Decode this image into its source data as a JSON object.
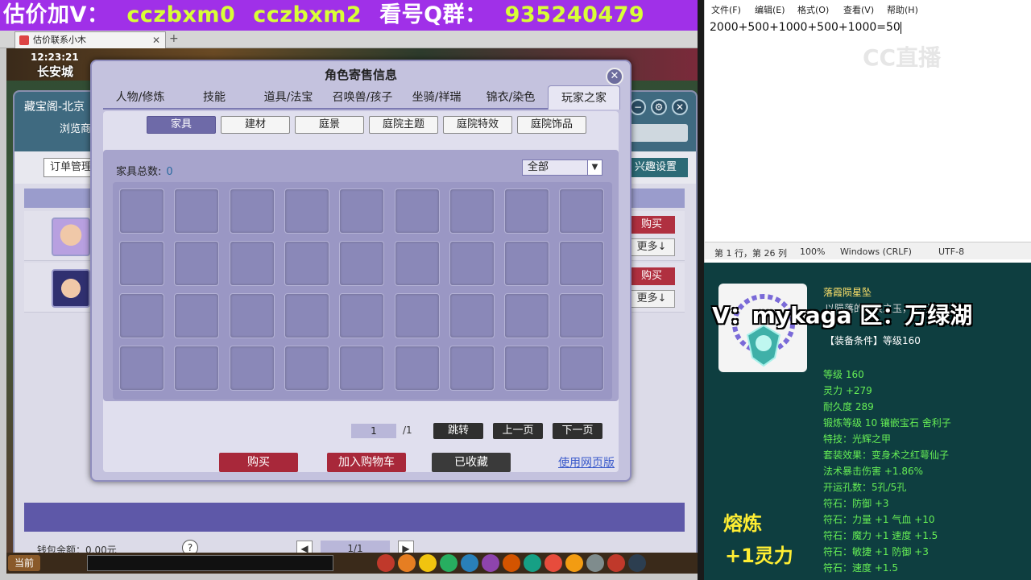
{
  "banner": {
    "part1": "估价加V：",
    "part2": "cczbxm0",
    "part3": "cczbxm2",
    "part4": "看号Q群：",
    "part5": "935240479"
  },
  "browser": {
    "tab_title": "估价联系小木"
  },
  "game": {
    "clock": "12:23:21",
    "city": "长安城",
    "shop": {
      "title": "藏宝阁-北京",
      "browse": "浏览商",
      "order_button": "订单管理",
      "interest_button": "兴趣设置",
      "buy": "购买",
      "more": "更多↓",
      "wallet": "钱包余额：0.00元",
      "help": "?",
      "pager_value": "1/1"
    },
    "now_button": "当前"
  },
  "dialog": {
    "title": "角色寄售信息",
    "tabs": [
      "人物/修炼",
      "技能",
      "道具/法宝",
      "召唤兽/孩子",
      "坐骑/祥瑞",
      "锦衣/染色",
      "玩家之家"
    ],
    "active_tab": "玩家之家",
    "subtabs": [
      "家具",
      "建材",
      "庭景",
      "庭院主题",
      "庭院特效",
      "庭院饰品"
    ],
    "active_subtab": "家具",
    "count_label": "家具总数:",
    "count_value": "0",
    "filter": "全部",
    "page_current": "1",
    "page_total": "/1",
    "jump": "跳转",
    "prev": "上一页",
    "next": "下一页",
    "buy": "购买",
    "add_cart": "加入购物车",
    "favorited": "已收藏",
    "web_link": "使用网页版"
  },
  "notepad": {
    "menu": [
      "文件(F)",
      "编辑(E)",
      "格式(O)",
      "查看(V)",
      "帮助(H)"
    ],
    "content": "2000+500+1000+500+1000=50",
    "status": {
      "position": "第 1 行，第 26 列",
      "zoom": "100%",
      "eol": "Windows (CRLF)",
      "encoding": "UTF-8"
    },
    "watermark": "CC直播"
  },
  "item": {
    "name": "落霞陨星坠",
    "desc": "以陨落的星辰之玉，亿万年光芒。",
    "overlay": "V：mykaga  区：万绿湖",
    "requirement": "【装备条件】等级160",
    "stats": [
      "等级 160",
      "灵力 +279",
      "耐久度 289",
      "锻炼等级 10  镶嵌宝石 舍利子",
      "特技：光辉之甲",
      "套装效果：变身术之红萼仙子",
      "法术暴击伤害 +1.86%",
      "开运孔数：5孔/5孔",
      "符石：防御 +3",
      "符石：力量 +1 气血 +10",
      "符石：魔力 +1 速度 +1.5",
      "符石：敏捷 +1 防御 +3",
      "符石：速度 +1.5"
    ],
    "refine_label": "熔炼",
    "refine_value": "+1灵力"
  }
}
